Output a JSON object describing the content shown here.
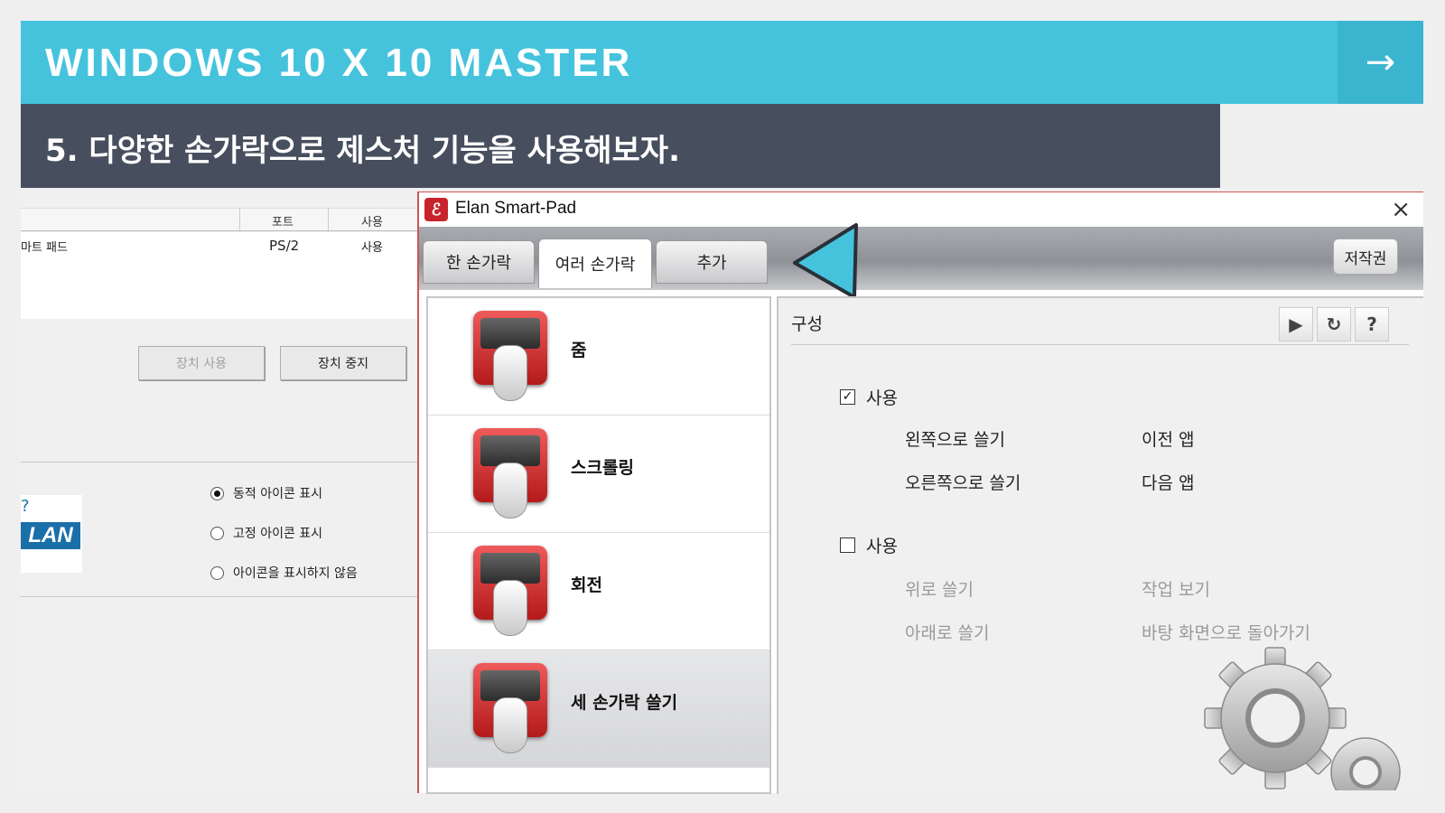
{
  "banner": {
    "title": "WINDOWS 10 X 10 MASTER",
    "arrow": "→"
  },
  "subtitle": "5. 다양한 손가락으로 제스처 기능을 사용해보자.",
  "background_window": {
    "columns": [
      "포트",
      "사용"
    ],
    "row": {
      "name": "마트 패드",
      "port": "PS/2",
      "status": "사용"
    },
    "buttons": {
      "enable": "장치 사용",
      "disable": "장치 중지"
    },
    "radio_options": [
      {
        "label": "동적 아이콘 표시",
        "selected": true
      },
      {
        "label": "고정 아이콘 표시",
        "selected": false
      },
      {
        "label": "아이콘을 표시하지 않음",
        "selected": false
      }
    ],
    "logo": "LAN"
  },
  "dialog": {
    "title": "Elan Smart-Pad",
    "close": "×",
    "icon_letter": "ℰ",
    "tabs": [
      {
        "label": "한 손가락",
        "active": false
      },
      {
        "label": "여러 손가락",
        "active": true
      },
      {
        "label": "추가",
        "active": false
      }
    ],
    "copyright_button": "저작권",
    "gestures": [
      {
        "label": "줌",
        "icon": "zoom-gesture-icon",
        "selected": false
      },
      {
        "label": "스크롤링",
        "icon": "scroll-gesture-icon",
        "selected": false
      },
      {
        "label": "회전",
        "icon": "rotate-gesture-icon",
        "selected": false
      },
      {
        "label": "세 손가락 쓸기",
        "icon": "three-finger-swipe-icon",
        "selected": true
      }
    ],
    "config": {
      "heading": "구성",
      "tools": [
        "play-icon",
        "reset-icon",
        "help-icon"
      ],
      "tool_glyphs": [
        "▶",
        "↻",
        "?"
      ],
      "group1": {
        "enabled_label": "사용",
        "checked": true,
        "actions": [
          {
            "gesture": "왼쪽으로 쓸기",
            "result": "이전 앱"
          },
          {
            "gesture": "오른쪽으로 쓸기",
            "result": "다음 앱"
          }
        ]
      },
      "group2": {
        "enabled_label": "사용",
        "checked": false,
        "actions": [
          {
            "gesture": "위로 쓸기",
            "result": "작업 보기"
          },
          {
            "gesture": "아래로 쓸기",
            "result": "바탕 화면으로 돌아가기"
          }
        ]
      }
    }
  },
  "colors": {
    "banner": "#45c3dd",
    "subtitle_bg": "#474e5d",
    "pointer": "#45c3dd",
    "icon_red": "#c8232c"
  }
}
